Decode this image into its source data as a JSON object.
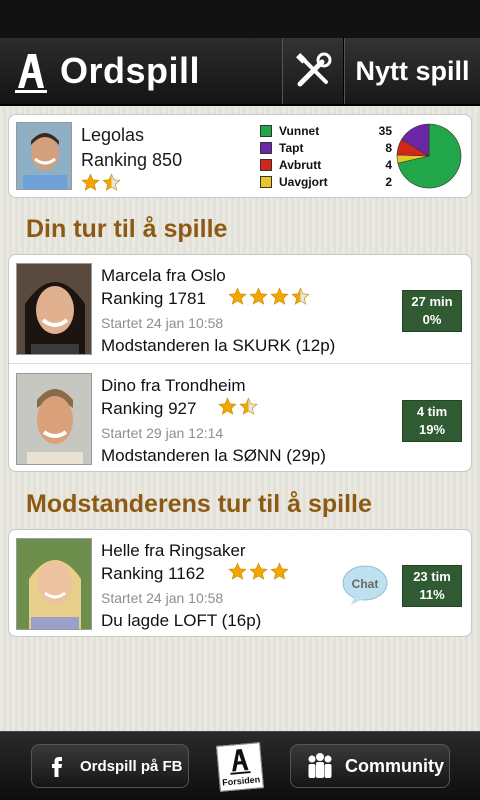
{
  "header": {
    "app_title": "Ordspill",
    "new_game_label": "Nytt spill"
  },
  "profile": {
    "name": "Legolas",
    "ranking": "Ranking 850",
    "stars": 1.5,
    "stats": [
      {
        "label": "Vunnet",
        "value": "35",
        "color": "#21a64a"
      },
      {
        "label": "Tapt",
        "value": "8",
        "color": "#6b27a6"
      },
      {
        "label": "Avbrutt",
        "value": "4",
        "color": "#d2251b"
      },
      {
        "label": "Uavgjort",
        "value": "2",
        "color": "#e8c820"
      }
    ]
  },
  "sections": {
    "your_turn": "Din tur til å spille",
    "opponent_turn": "Modstanderens tur til å spille"
  },
  "your_turn_games": [
    {
      "name": "Marcela fra Oslo",
      "ranking": "Ranking 1781",
      "stars": 3.5,
      "started": "Startet 24 jan 10:58",
      "last_move": "Modstanderen la SKURK (12p)",
      "time": "27 min",
      "percent": "0%"
    },
    {
      "name": "Dino fra Trondheim",
      "ranking": "Ranking 927",
      "stars": 1.5,
      "started": "Startet 29 jan 12:14",
      "last_move": "Modstanderen la SØNN (29p)",
      "time": "4 tim",
      "percent": "19%"
    }
  ],
  "opponent_turn_games": [
    {
      "name": "Helle fra Ringsaker",
      "ranking": "Ranking 1162",
      "stars": 3,
      "started": "Startet 24 jan 10:58",
      "last_move": "Du lagde LOFT (16p)",
      "time": "23 tim",
      "percent": "11%",
      "chat_label": "Chat"
    }
  ],
  "bottom_bar": {
    "fb_label": "Ordspill på FB",
    "forsiden_label": "Forsiden",
    "community_label": "Community"
  },
  "colors": {
    "accent_brown": "#8c5a12",
    "badge_green": "#2f5a32",
    "star_gold": "#f2a600"
  },
  "icons": [
    "logo-icon",
    "tools-icon",
    "star-icon",
    "chat-bubble-icon",
    "facebook-icon",
    "community-icon"
  ]
}
